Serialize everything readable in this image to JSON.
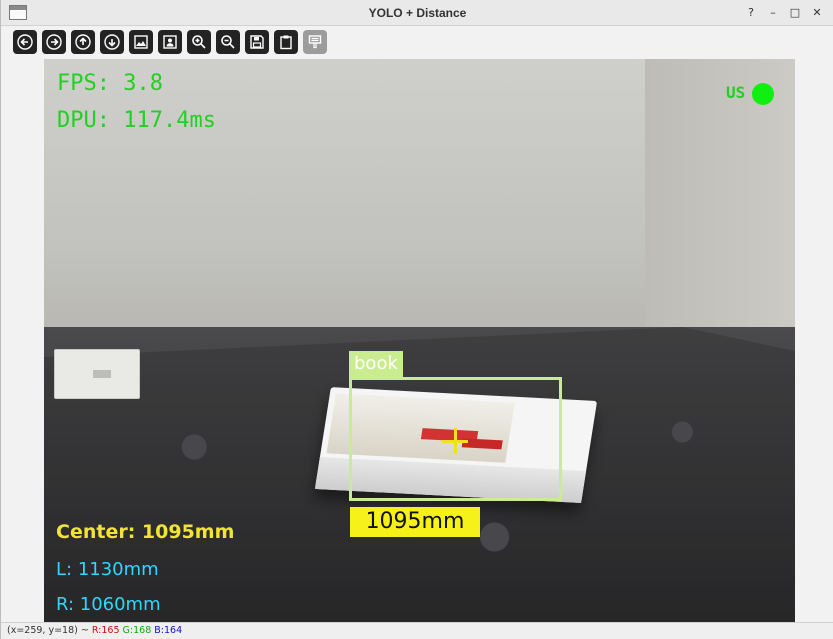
{
  "window": {
    "title": "YOLO + Distance",
    "controls": {
      "help": "?",
      "minimize": "–",
      "maximize": "□",
      "close": "✕"
    }
  },
  "toolbar": {
    "buttons": [
      {
        "name": "pan-left",
        "icon": "arrow-left-icon"
      },
      {
        "name": "pan-right",
        "icon": "arrow-right-icon"
      },
      {
        "name": "pan-up",
        "icon": "arrow-up-icon"
      },
      {
        "name": "pan-down",
        "icon": "arrow-down-icon"
      },
      {
        "name": "zoom-fit",
        "icon": "image-icon"
      },
      {
        "name": "zoom-original",
        "icon": "image-person-icon"
      },
      {
        "name": "zoom-in",
        "icon": "zoom-in-icon"
      },
      {
        "name": "zoom-out",
        "icon": "zoom-out-icon"
      },
      {
        "name": "save",
        "icon": "floppy-icon"
      },
      {
        "name": "copy",
        "icon": "clipboard-icon"
      },
      {
        "name": "properties",
        "icon": "properties-icon"
      }
    ]
  },
  "overlay": {
    "fps": "FPS: 3.8",
    "dpu": "DPU: 117.4ms",
    "ultrasonic_label": "US",
    "detection": {
      "label": "book",
      "distance": "1095mm"
    },
    "center": "Center: 1095mm",
    "left": "L: 1130mm",
    "right": "R: 1060mm"
  },
  "status": {
    "coords": "(x=259, y=18) ~",
    "r": "R:165",
    "g": "G:168",
    "b": "B:164"
  },
  "colors": {
    "hud_green": "#22d022",
    "bbox": "#c9ec8f",
    "distance_badge": "#f7f11a",
    "center_text": "#f2e433",
    "side_text": "#2bd8ff"
  }
}
